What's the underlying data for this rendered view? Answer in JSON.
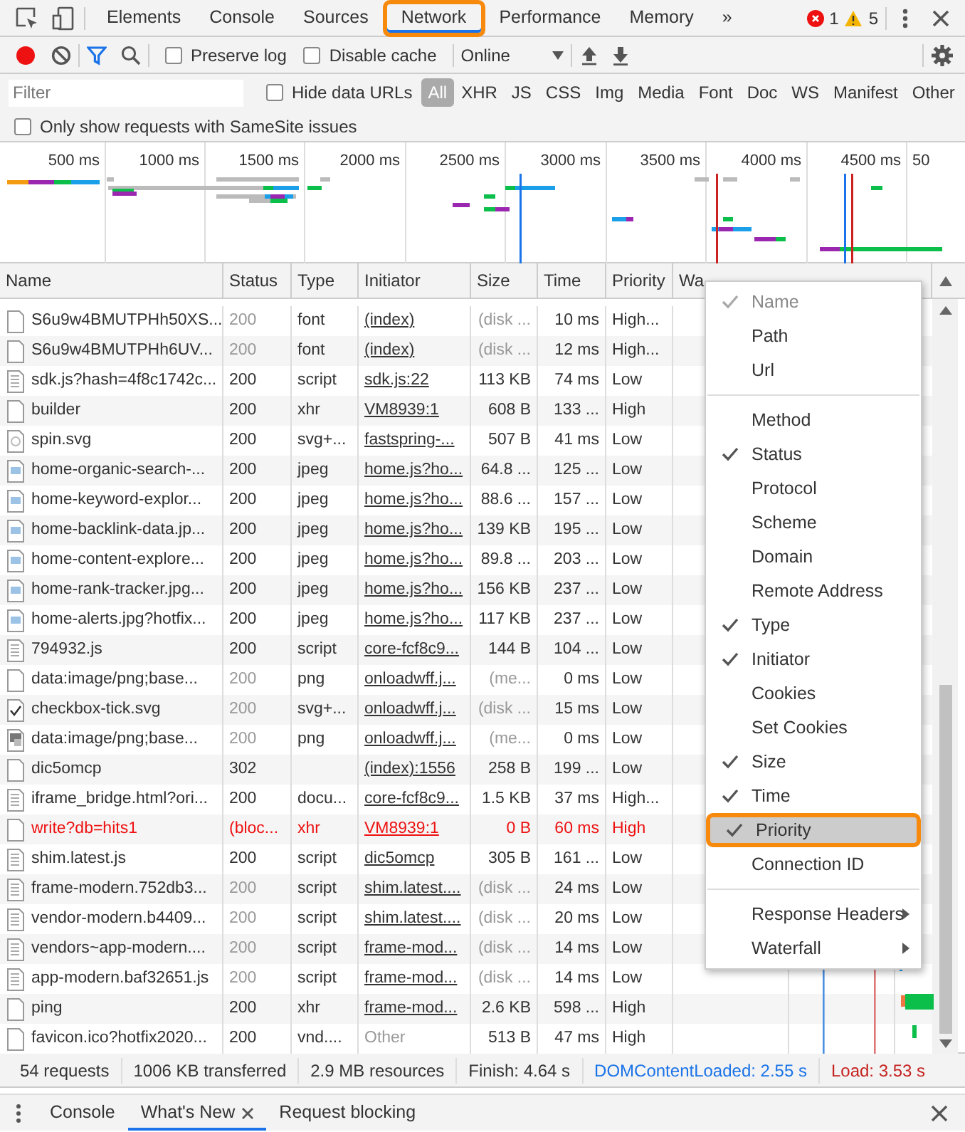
{
  "main_tabs": [
    {
      "label": "Elements",
      "selected": false,
      "callout": false
    },
    {
      "label": "Console",
      "selected": false,
      "callout": false
    },
    {
      "label": "Sources",
      "selected": false,
      "callout": false
    },
    {
      "label": "Network",
      "selected": true,
      "callout": true
    },
    {
      "label": "Performance",
      "selected": false,
      "callout": false
    },
    {
      "label": "Memory",
      "selected": false,
      "callout": false
    }
  ],
  "more_tabs": "»",
  "errors": "1",
  "warnings": "5",
  "toolbar": {
    "recording": true,
    "filter_shown": true,
    "preserve_log": {
      "label": "Preserve log",
      "checked": false
    },
    "disable_cache": {
      "label": "Disable cache",
      "checked": false
    },
    "throttling": "Online"
  },
  "filter": {
    "placeholder": "Filter",
    "hide_data_urls": {
      "label": "Hide data URLs",
      "checked": false
    },
    "types": [
      {
        "label": "All",
        "selected": true
      },
      {
        "label": "XHR",
        "selected": false
      },
      {
        "label": "JS",
        "selected": false
      },
      {
        "label": "CSS",
        "selected": false
      },
      {
        "label": "Img",
        "selected": false
      },
      {
        "label": "Media",
        "selected": false
      },
      {
        "label": "Font",
        "selected": false
      },
      {
        "label": "Doc",
        "selected": false
      },
      {
        "label": "WS",
        "selected": false
      },
      {
        "label": "Manifest",
        "selected": false
      },
      {
        "label": "Other",
        "selected": false
      }
    ]
  },
  "samesite_only": {
    "label": "Only show requests with SameSite issues",
    "checked": false
  },
  "overview": {
    "ticks": [
      "500 ms",
      "1000 ms",
      "1500 ms",
      "2000 ms",
      "2500 ms",
      "3000 ms",
      "3500 ms",
      "4000 ms",
      "4500 ms",
      "50"
    ]
  },
  "table": {
    "columns": [
      "Name",
      "Status",
      "Type",
      "Initiator",
      "Size",
      "Time",
      "Priority",
      "Wa"
    ],
    "rows": [
      {
        "kind": "blank",
        "name": "S6u9w4BMUTPHh50XS...",
        "status": "200",
        "type": "font",
        "initiator": "(index)",
        "initiator_link": true,
        "size": "(disk ...",
        "time": "10 ms",
        "priority": "High...",
        "cached": true,
        "error": false
      },
      {
        "kind": "blank",
        "name": "S6u9w4BMUTPHh6UV...",
        "status": "200",
        "type": "font",
        "initiator": "(index)",
        "initiator_link": true,
        "size": "(disk ...",
        "time": "12 ms",
        "priority": "High...",
        "cached": true,
        "error": false
      },
      {
        "kind": "lines",
        "name": "sdk.js?hash=4f8c1742c...",
        "status": "200",
        "type": "script",
        "initiator": "sdk.js:22",
        "initiator_link": true,
        "size": "113 KB",
        "time": "74 ms",
        "priority": "Low",
        "cached": false,
        "error": false
      },
      {
        "kind": "blank",
        "name": "builder",
        "status": "200",
        "type": "xhr",
        "initiator": "VM8939:1",
        "initiator_link": true,
        "size": "608 B",
        "time": "133 ...",
        "priority": "High",
        "cached": false,
        "error": false
      },
      {
        "kind": "spin",
        "name": "spin.svg",
        "status": "200",
        "type": "svg+...",
        "initiator": "fastspring-...",
        "initiator_link": true,
        "size": "507 B",
        "time": "41 ms",
        "priority": "Low",
        "cached": false,
        "error": false
      },
      {
        "kind": "image",
        "name": "home-organic-search-...",
        "status": "200",
        "type": "jpeg",
        "initiator": "home.js?ho...",
        "initiator_link": true,
        "size": "64.8 ...",
        "time": "125 ...",
        "priority": "Low",
        "cached": false,
        "error": false
      },
      {
        "kind": "image",
        "name": "home-keyword-explor...",
        "status": "200",
        "type": "jpeg",
        "initiator": "home.js?ho...",
        "initiator_link": true,
        "size": "88.6 ...",
        "time": "157 ...",
        "priority": "Low",
        "cached": false,
        "error": false
      },
      {
        "kind": "image",
        "name": "home-backlink-data.jp...",
        "status": "200",
        "type": "jpeg",
        "initiator": "home.js?ho...",
        "initiator_link": true,
        "size": "139 KB",
        "time": "195 ...",
        "priority": "Low",
        "cached": false,
        "error": false
      },
      {
        "kind": "image",
        "name": "home-content-explore...",
        "status": "200",
        "type": "jpeg",
        "initiator": "home.js?ho...",
        "initiator_link": true,
        "size": "89.8 ...",
        "time": "203 ...",
        "priority": "Low",
        "cached": false,
        "error": false
      },
      {
        "kind": "image",
        "name": "home-rank-tracker.jpg...",
        "status": "200",
        "type": "jpeg",
        "initiator": "home.js?ho...",
        "initiator_link": true,
        "size": "156 KB",
        "time": "237 ...",
        "priority": "Low",
        "cached": false,
        "error": false
      },
      {
        "kind": "image",
        "name": "home-alerts.jpg?hotfix...",
        "status": "200",
        "type": "jpeg",
        "initiator": "home.js?ho...",
        "initiator_link": true,
        "size": "117 KB",
        "time": "237 ...",
        "priority": "Low",
        "cached": false,
        "error": false
      },
      {
        "kind": "lines",
        "name": "794932.js",
        "status": "200",
        "type": "script",
        "initiator": "core-fcf8c9...",
        "initiator_link": true,
        "size": "144 B",
        "time": "104 ...",
        "priority": "Low",
        "cached": false,
        "error": false
      },
      {
        "kind": "blank",
        "name": "data:image/png;base...",
        "status": "200",
        "type": "png",
        "initiator": "onloadwff.j...",
        "initiator_link": true,
        "size": "(me...",
        "time": "0 ms",
        "priority": "Low",
        "cached": true,
        "error": false
      },
      {
        "kind": "tick",
        "name": "checkbox-tick.svg",
        "status": "200",
        "type": "svg+...",
        "initiator": "onloadwff.j...",
        "initiator_link": true,
        "size": "(disk ...",
        "time": "15 ms",
        "priority": "Low",
        "cached": true,
        "error": false
      },
      {
        "kind": "thumb",
        "name": "data:image/png;base...",
        "status": "200",
        "type": "png",
        "initiator": "onloadwff.j...",
        "initiator_link": true,
        "size": "(me...",
        "time": "0 ms",
        "priority": "Low",
        "cached": true,
        "error": false
      },
      {
        "kind": "blank",
        "name": "dic5omcp",
        "status": "302",
        "initiator": "(index):1556",
        "initiator_link": true,
        "size": "258 B",
        "time": "199 ...",
        "priority": "Low",
        "cached": false,
        "error": false
      },
      {
        "kind": "lines",
        "name": "iframe_bridge.html?ori...",
        "status": "200",
        "type": "docu...",
        "initiator": "core-fcf8c9...",
        "initiator_link": true,
        "size": "1.5 KB",
        "time": "37 ms",
        "priority": "High...",
        "cached": false,
        "error": false
      },
      {
        "kind": "blank",
        "name": "write?db=hits1",
        "status": "(bloc...",
        "type": "xhr",
        "initiator": "VM8939:1",
        "initiator_link": true,
        "size": "0 B",
        "time": "60 ms",
        "priority": "High",
        "cached": false,
        "error": true
      },
      {
        "kind": "lines",
        "name": "shim.latest.js",
        "status": "200",
        "type": "script",
        "initiator": "dic5omcp",
        "initiator_link": true,
        "size": "305 B",
        "time": "161 ...",
        "priority": "Low",
        "cached": false,
        "error": false
      },
      {
        "kind": "lines",
        "name": "frame-modern.752db3...",
        "status": "200",
        "type": "script",
        "initiator": "shim.latest....",
        "initiator_link": true,
        "size": "(disk ...",
        "time": "24 ms",
        "priority": "Low",
        "cached": true,
        "error": false
      },
      {
        "kind": "lines",
        "name": "vendor-modern.b4409...",
        "status": "200",
        "type": "script",
        "initiator": "shim.latest....",
        "initiator_link": true,
        "size": "(disk ...",
        "time": "20 ms",
        "priority": "Low",
        "cached": true,
        "error": false
      },
      {
        "kind": "lines",
        "name": "vendors~app-modern....",
        "status": "200",
        "type": "script",
        "initiator": "frame-mod...",
        "initiator_link": true,
        "size": "(disk ...",
        "time": "14 ms",
        "priority": "Low",
        "cached": true,
        "error": false
      },
      {
        "kind": "lines",
        "name": "app-modern.baf32651.js",
        "status": "200",
        "type": "script",
        "initiator": "frame-mod...",
        "initiator_link": true,
        "size": "(disk ...",
        "time": "14 ms",
        "priority": "Low",
        "cached": true,
        "error": false
      },
      {
        "kind": "blank",
        "name": "ping",
        "status": "200",
        "type": "xhr",
        "initiator": "frame-mod...",
        "initiator_link": true,
        "size": "2.6 KB",
        "time": "598 ...",
        "priority": "High",
        "cached": false,
        "error": false
      },
      {
        "kind": "blank",
        "name": "favicon.ico?hotfix2020...",
        "status": "200",
        "type": "vnd....",
        "initiator": "Other",
        "initiator_link": false,
        "size": "513 B",
        "time": "47 ms",
        "priority": "High",
        "cached": false,
        "error": false
      }
    ]
  },
  "context_menu": {
    "groups": [
      [
        {
          "label": "Name",
          "checked": true,
          "disabled": true,
          "selected": false,
          "callout": false,
          "submenu": false
        },
        {
          "label": "Path",
          "checked": false,
          "disabled": false,
          "selected": false,
          "callout": false,
          "submenu": false
        },
        {
          "label": "Url",
          "checked": false,
          "disabled": false,
          "selected": false,
          "callout": false,
          "submenu": false
        }
      ],
      [
        {
          "label": "Method",
          "checked": false,
          "disabled": false,
          "selected": false,
          "callout": false,
          "submenu": false
        },
        {
          "label": "Status",
          "checked": true,
          "disabled": false,
          "selected": false,
          "callout": false,
          "submenu": false
        },
        {
          "label": "Protocol",
          "checked": false,
          "disabled": false,
          "selected": false,
          "callout": false,
          "submenu": false
        },
        {
          "label": "Scheme",
          "checked": false,
          "disabled": false,
          "selected": false,
          "callout": false,
          "submenu": false
        },
        {
          "label": "Domain",
          "checked": false,
          "disabled": false,
          "selected": false,
          "callout": false,
          "submenu": false
        },
        {
          "label": "Remote Address",
          "checked": false,
          "disabled": false,
          "selected": false,
          "callout": false,
          "submenu": false
        },
        {
          "label": "Type",
          "checked": true,
          "disabled": false,
          "selected": false,
          "callout": false,
          "submenu": false
        },
        {
          "label": "Initiator",
          "checked": true,
          "disabled": false,
          "selected": false,
          "callout": false,
          "submenu": false
        },
        {
          "label": "Cookies",
          "checked": false,
          "disabled": false,
          "selected": false,
          "callout": false,
          "submenu": false
        },
        {
          "label": "Set Cookies",
          "checked": false,
          "disabled": false,
          "selected": false,
          "callout": false,
          "submenu": false
        },
        {
          "label": "Size",
          "checked": true,
          "disabled": false,
          "selected": false,
          "callout": false,
          "submenu": false
        },
        {
          "label": "Time",
          "checked": true,
          "disabled": false,
          "selected": false,
          "callout": false,
          "submenu": false
        },
        {
          "label": "Priority",
          "checked": true,
          "disabled": false,
          "selected": true,
          "callout": true,
          "submenu": false
        },
        {
          "label": "Connection ID",
          "checked": false,
          "disabled": false,
          "selected": false,
          "callout": false,
          "submenu": false
        }
      ],
      [
        {
          "label": "Response Headers",
          "checked": false,
          "disabled": false,
          "selected": false,
          "callout": false,
          "submenu": true
        },
        {
          "label": "Waterfall",
          "checked": false,
          "disabled": false,
          "selected": false,
          "callout": false,
          "submenu": true
        }
      ]
    ]
  },
  "status_bar": [
    {
      "text": "54 requests",
      "kind": "plain"
    },
    {
      "text": "1006 KB transferred",
      "kind": "plain"
    },
    {
      "text": "2.9 MB resources",
      "kind": "plain"
    },
    {
      "text": "Finish: 4.64 s",
      "kind": "plain"
    },
    {
      "text": "DOMContentLoaded: 2.55 s",
      "kind": "dom"
    },
    {
      "text": "Load: 3.53 s",
      "kind": "load"
    }
  ],
  "drawer_tabs": [
    {
      "label": "Console",
      "selected": false,
      "closable": false
    },
    {
      "label": "What's New",
      "selected": true,
      "closable": true
    },
    {
      "label": "Request blocking",
      "selected": false,
      "closable": false
    }
  ]
}
